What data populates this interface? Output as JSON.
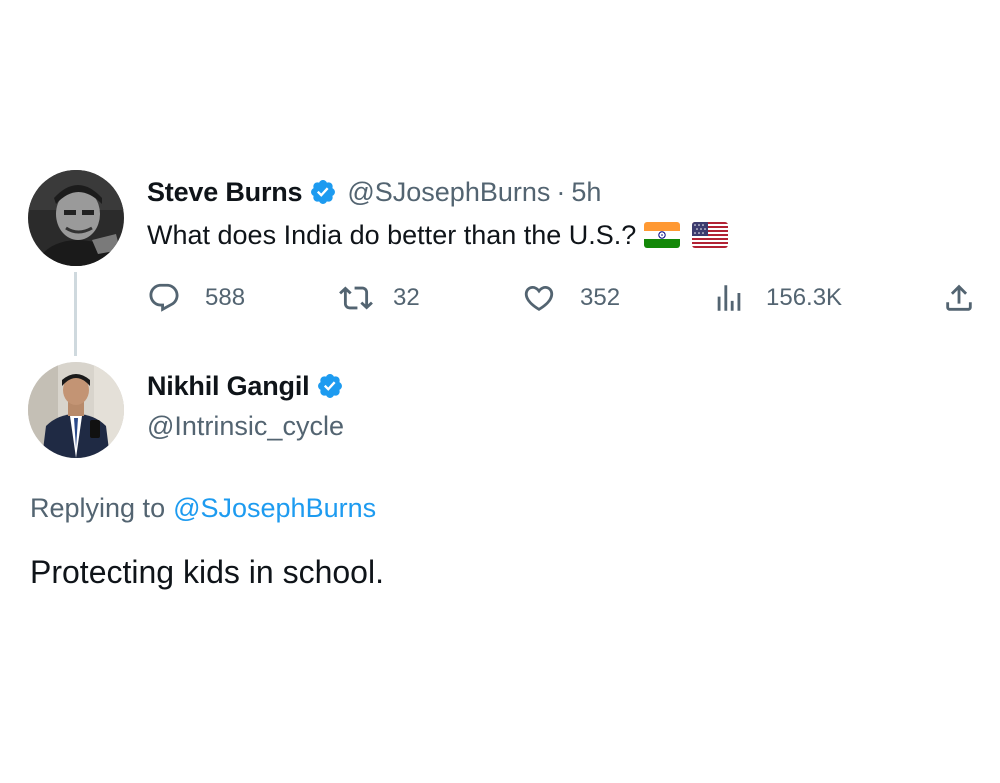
{
  "tweet": {
    "author": {
      "name": "Steve Burns",
      "handle": "@SJosephBurns",
      "verified": true
    },
    "separator": "·",
    "time": "5h",
    "text": "What does India do better than the U.S.?",
    "emojis": [
      "flag-india",
      "flag-usa"
    ],
    "stats": {
      "replies": "588",
      "retweets": "32",
      "likes": "352",
      "views": "156.3K"
    }
  },
  "reply": {
    "author": {
      "name": "Nikhil Gangil",
      "handle": "@Intrinsic_cycle",
      "verified": true
    },
    "replying_to_label": "Replying to",
    "replying_to_handle": "@SJosephBurns",
    "text": "Protecting kids in school."
  },
  "icons": {
    "reply": "speech-bubble-icon",
    "retweet": "retweet-icon",
    "like": "heart-icon",
    "views": "bar-chart-icon",
    "share": "share-upload-icon",
    "verified": "verified-badge-icon"
  },
  "colors": {
    "text_primary": "#0f1419",
    "text_secondary": "#536471",
    "link": "#1d9bf0",
    "verified": "#1d9bf0",
    "thread_line": "#cfd9de"
  }
}
